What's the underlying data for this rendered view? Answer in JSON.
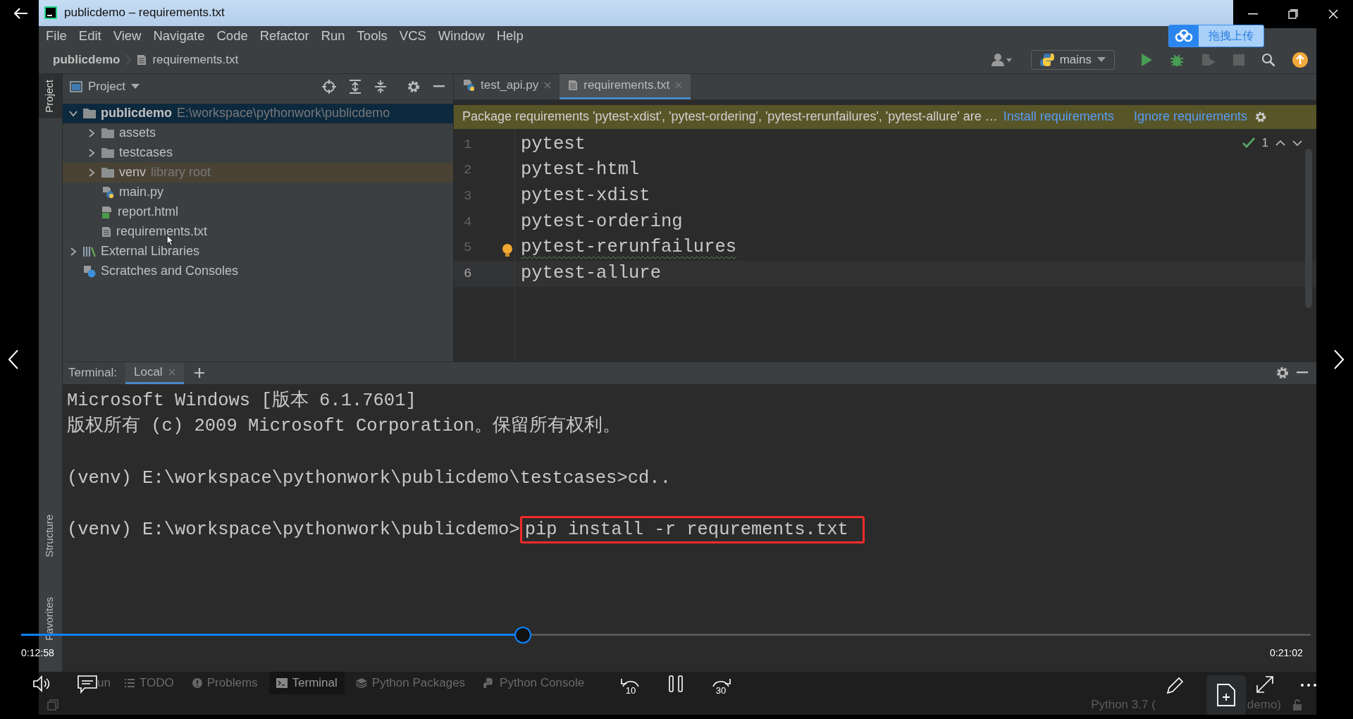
{
  "player": {
    "elapsed": "0:12:58",
    "duration": "0:21:02",
    "level": 0.389,
    "upload_badge": "拖拽上传",
    "rewind_label": "10",
    "forward_label": "30"
  },
  "window": {
    "title": "publicdemo – requirements.txt"
  },
  "menu": [
    "File",
    "Edit",
    "View",
    "Navigate",
    "Code",
    "Refactor",
    "Run",
    "Tools",
    "VCS",
    "Window",
    "Help"
  ],
  "breadcrumb": [
    "publicdemo",
    "requirements.txt"
  ],
  "run_config": "mains",
  "tool_strip": [
    {
      "label": "Project",
      "selected": true
    },
    {
      "label": "Structure",
      "selected": false
    },
    {
      "label": "Favorites",
      "selected": false
    }
  ],
  "project_panel": {
    "title": "Project",
    "tree": [
      {
        "name": "publicdemo",
        "path": "E:\\workspace\\pythonwork\\publicdemo",
        "kind": "folder",
        "expanded": true,
        "selected": true,
        "highlighted": false,
        "children": [
          {
            "name": "assets",
            "kind": "folder",
            "expanded": false,
            "selected": false,
            "highlighted": false
          },
          {
            "name": "testcases",
            "kind": "folder",
            "expanded": false,
            "selected": false,
            "highlighted": false
          },
          {
            "name": "venv",
            "hint": "library root",
            "kind": "folder",
            "expanded": false,
            "selected": false,
            "highlighted": true
          },
          {
            "name": "main.py",
            "kind": "python",
            "selected": false,
            "highlighted": false
          },
          {
            "name": "report.html",
            "kind": "html",
            "selected": false,
            "highlighted": false
          },
          {
            "name": "requirements.txt",
            "kind": "text",
            "selected": false,
            "highlighted": false
          }
        ]
      },
      {
        "name": "External Libraries",
        "kind": "libraries",
        "expanded": false,
        "selected": false,
        "highlighted": false
      },
      {
        "name": "Scratches and Consoles",
        "kind": "scratches",
        "selected": false,
        "highlighted": false
      }
    ]
  },
  "editor": {
    "tabs": [
      {
        "label": "test_api.py",
        "kind": "python",
        "selected": false
      },
      {
        "label": "requirements.txt",
        "kind": "text",
        "selected": true
      }
    ],
    "notice": {
      "text": "Package requirements 'pytest-xdist', 'pytest-ordering', 'pytest-rerunfailures', 'pytest-allure' are …",
      "actions": [
        "Install requirements",
        "Ignore requirements"
      ]
    },
    "inspection_count": "1",
    "lines": [
      {
        "number": "1",
        "text": "pytest",
        "warning": false,
        "current": false
      },
      {
        "number": "2",
        "text": "pytest-html",
        "warning": false,
        "current": false
      },
      {
        "number": "3",
        "text": "pytest-xdist",
        "warning": false,
        "current": false
      },
      {
        "number": "4",
        "text": "pytest-ordering",
        "warning": false,
        "current": false
      },
      {
        "number": "5",
        "text": "pytest-rerunfailures",
        "warning": true,
        "current": false
      },
      {
        "number": "6",
        "text": "pytest-allure",
        "warning": false,
        "current": true
      }
    ]
  },
  "terminal": {
    "label": "Terminal:",
    "tabs": [
      {
        "label": "Local",
        "selected": true
      }
    ],
    "lines": [
      {
        "kind": "output",
        "text": "Microsoft Windows [版本 6.1.7601]"
      },
      {
        "kind": "output",
        "text": "版权所有 (c) 2009 Microsoft Corporation。保留所有权利。"
      },
      {
        "kind": "blank"
      },
      {
        "kind": "prompt",
        "prompt": "(venv) E:\\workspace\\pythonwork\\publicdemo\\testcases>",
        "command": "cd..",
        "highlighted": false
      },
      {
        "kind": "blank"
      },
      {
        "kind": "prompt",
        "prompt": "(venv) E:\\workspace\\pythonwork\\publicdemo>",
        "command": "pip install -r requrements.txt",
        "highlighted": true
      }
    ]
  },
  "bottom_tabs": [
    {
      "label": "un",
      "kind": "run",
      "selected": false
    },
    {
      "label": "TODO",
      "kind": "todo",
      "selected": false
    },
    {
      "label": "Problems",
      "kind": "problems",
      "selected": false
    },
    {
      "label": "Terminal",
      "kind": "terminal",
      "selected": true
    },
    {
      "label": "Python Packages",
      "kind": "packages",
      "selected": false
    },
    {
      "label": "Python Console",
      "kind": "console",
      "selected": false
    }
  ],
  "status": {
    "interpreter_start": "Python 3.7 (",
    "interpreter_end": "demo)"
  }
}
